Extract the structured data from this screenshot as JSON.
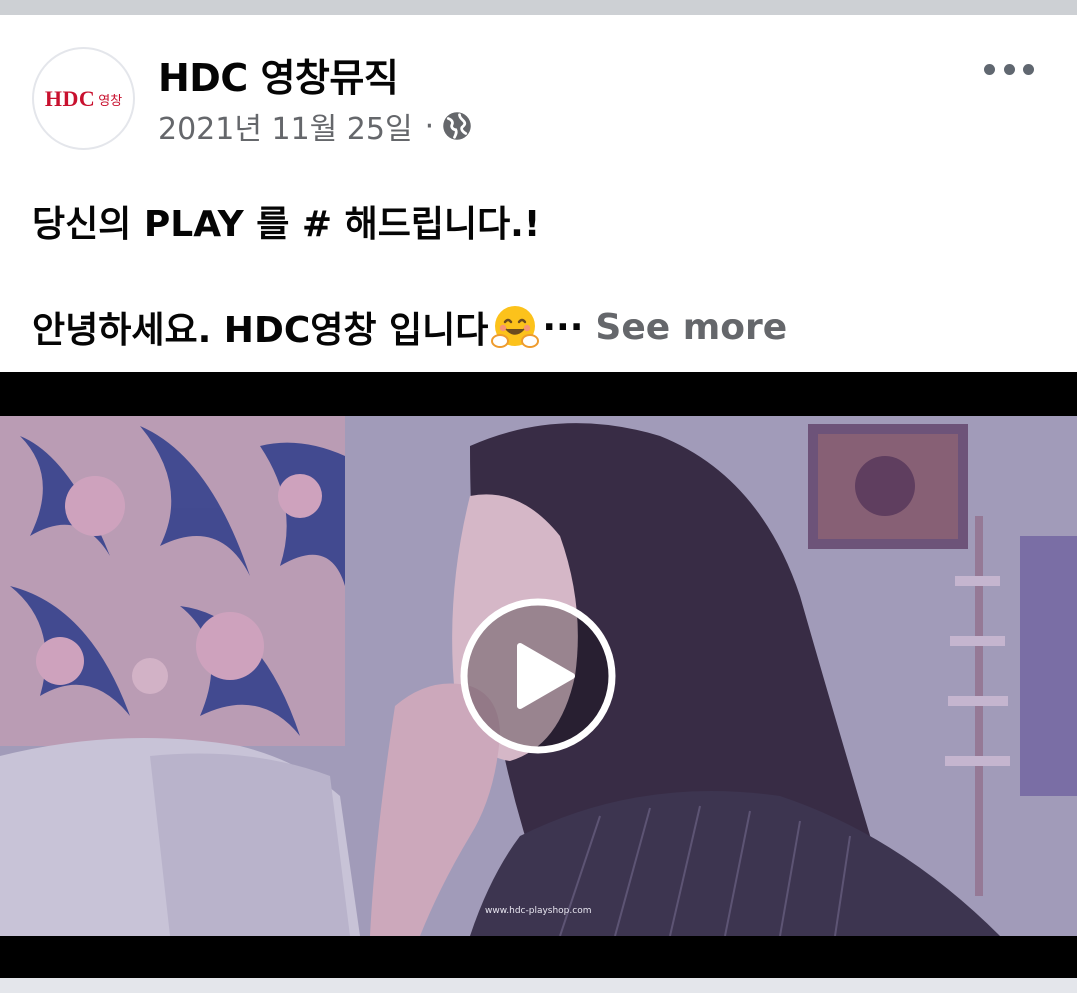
{
  "post": {
    "page_name": "HDC 영창뮤직",
    "avatar": {
      "logo_text": "HDC",
      "logo_subtext": "영창",
      "brand_color": "#c8102e"
    },
    "date": "2021년 11월 25일",
    "separator": "·",
    "audience_icon": "globe-icon",
    "more_icon": "more-options-icon",
    "text": {
      "line1": "당신의 PLAY 를 # 해드립니다.!",
      "line2": "안녕하세요. HDC영창 입니다",
      "emoji": "hugging-face-emoji",
      "ellipsis": "···",
      "see_more": "See more"
    },
    "video": {
      "play_icon": "play-icon",
      "watermark": "www.hdc-playshop.com"
    }
  },
  "colors": {
    "text_primary": "#050505",
    "text_secondary": "#65676b",
    "background": "#ffffff",
    "letterbox": "#000000"
  }
}
